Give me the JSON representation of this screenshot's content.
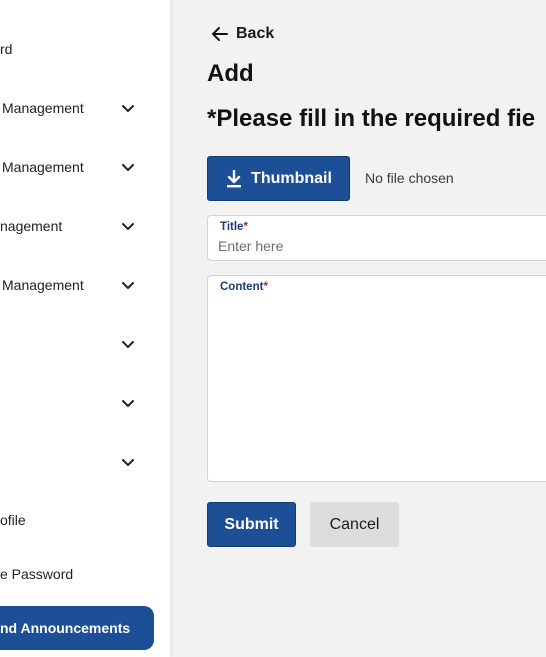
{
  "sidebar": {
    "items": [
      {
        "label": "rd",
        "has_chevron": false
      },
      {
        "label": "Management",
        "has_chevron": true
      },
      {
        "label": "Management",
        "has_chevron": true
      },
      {
        "label": "nagement",
        "has_chevron": true
      },
      {
        "label": "Management",
        "has_chevron": true
      },
      {
        "label": "",
        "has_chevron": true
      },
      {
        "label": "",
        "has_chevron": true
      },
      {
        "label": "",
        "has_chevron": true
      },
      {
        "label": "ofile",
        "has_chevron": false
      },
      {
        "label": "e Password",
        "has_chevron": false
      }
    ],
    "active_item": {
      "label": "nd Announcements"
    }
  },
  "header": {
    "back_label": "Back",
    "page_title": "Add",
    "required_notice": "*Please fill in the required fie"
  },
  "thumbnail": {
    "button_label": "Thumbnail",
    "file_status": "No file chosen"
  },
  "form": {
    "title_label": "Title",
    "title_required_mark": "*",
    "title_placeholder": "Enter here",
    "content_label": "Content",
    "content_required_mark": "*"
  },
  "actions": {
    "submit_label": "Submit",
    "cancel_label": "Cancel"
  },
  "colors": {
    "primary": "#1c4f96",
    "required": "#d01c1c",
    "page_background": "#f2f2f2"
  }
}
